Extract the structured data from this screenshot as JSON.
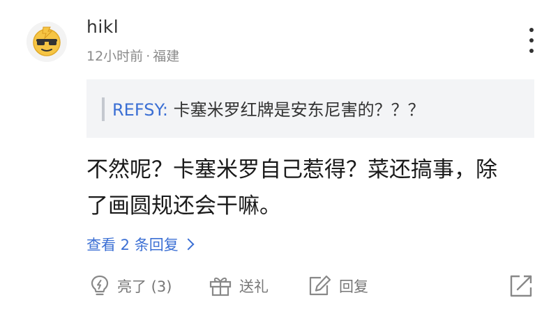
{
  "comment": {
    "username": "hikl",
    "time": "12小时前",
    "separator": "·",
    "location": "福建",
    "quote": {
      "user": "REFSY:",
      "text": "卡塞米罗红牌是安东尼害的？？？"
    },
    "body_line1": "不然呢？卡塞米罗自己惹得？菜还搞事，除",
    "body_line2": "了画圆规还会干嘛。",
    "view_replies": "查看 2 条回复"
  },
  "actions": {
    "like_label": "亮了 (3)",
    "gift_label": "送礼",
    "reply_label": "回复"
  },
  "icons": {
    "avatar": "avatar-sunglasses-icon",
    "more": "more-vertical-icon",
    "like": "lightbulb-icon",
    "gift": "gift-icon",
    "reply": "edit-pen-icon",
    "share": "share-out-icon",
    "chevron": "chevron-right-icon"
  },
  "colors": {
    "link": "#3b6fd4",
    "muted": "#8a8a8a",
    "quote_bg": "#f3f4f6",
    "avatar_yellow": "#f6c544"
  }
}
